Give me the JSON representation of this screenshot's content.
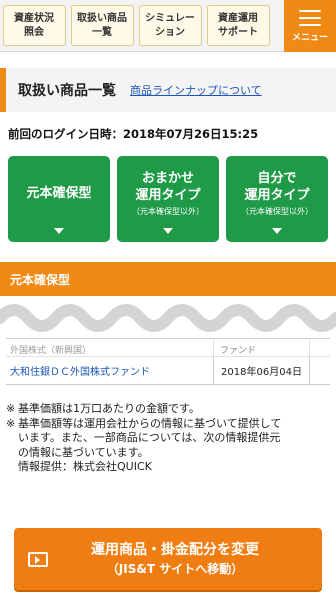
{
  "topnav": {
    "items": [
      {
        "line1": "資産状況",
        "line2": "照会"
      },
      {
        "line1": "取扱い商品",
        "line2": "一覧"
      },
      {
        "line1": "シミュレー",
        "line2": "ション"
      },
      {
        "line1": "資産運用",
        "line2": "サポート"
      }
    ],
    "menu_label": "メニュー"
  },
  "section": {
    "title": "取扱い商品一覧",
    "lineup_link": "商品ラインナップについて"
  },
  "last_login": "前回のログイン日時：2018年07月26日15:25",
  "categories": [
    {
      "line1": "元本確保型",
      "line2": "",
      "sub": ""
    },
    {
      "line1": "おまかせ",
      "line2": "運用タイプ",
      "sub": "（元本確保型以外）"
    },
    {
      "line1": "自分で",
      "line2": "運用タイプ",
      "sub": "（元本確保型以外）"
    }
  ],
  "category_bar": "元本確保型",
  "table": {
    "rows": [
      {
        "name": "外国株式（新興国）",
        "date": "ファンド",
        "partial": true
      },
      {
        "name": "大和住銀ＤＣ外国株式ファンド",
        "date": "2018年06月04日"
      }
    ]
  },
  "notes": [
    {
      "mark": "※",
      "text": "基準価額は1万口あたりの金額です。"
    },
    {
      "mark": "※",
      "text": "基準価額等は運用会社からの情報に基づいて提供して"
    },
    {
      "mark": "",
      "text": "います。また、一部商品については、次の情報提供元"
    },
    {
      "mark": "",
      "text": "の情報に基づいています。"
    },
    {
      "mark": "",
      "text": "情報提供：株式会社QUICK"
    }
  ],
  "cta": {
    "line1": "運用商品・掛金配分を変更",
    "line2": "（JIS&T サイトへ移動）"
  },
  "colors": {
    "accent_orange": "#f08a14",
    "green": "#1f9a47",
    "link_blue": "#1a56b8"
  }
}
